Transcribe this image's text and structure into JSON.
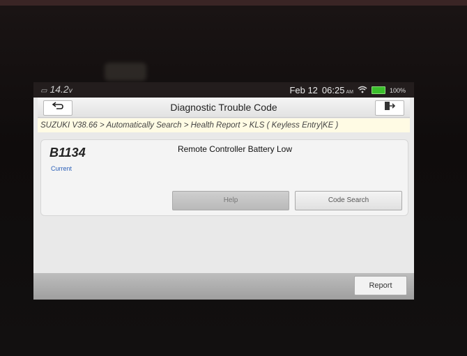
{
  "status_bar": {
    "voltage": "14.2",
    "voltage_unit": "v",
    "date": "Feb 12",
    "time": "06:25",
    "ampm": "AM",
    "battery": "100%",
    "icons": [
      "car-battery-icon",
      "wifi-icon",
      "battery-icon"
    ]
  },
  "header": {
    "title": "Diagnostic Trouble Code",
    "back_icon": "back-arrow-icon",
    "exit_icon": "exit-icon"
  },
  "breadcrumb": "SUZUKI V38.66 > Automatically Search > Health Report > KLS ( Keyless Entry|KE )",
  "dtc": {
    "code": "B1134",
    "status": "Current",
    "description": "Remote Controller Battery Low",
    "help_label": "Help",
    "code_search_label": "Code Search"
  },
  "footer": {
    "report_label": "Report"
  },
  "colors": {
    "breadcrumb_bg": "#fffbe4",
    "status_text": "#2a5fb8",
    "battery_green": "#3bbf2c"
  }
}
